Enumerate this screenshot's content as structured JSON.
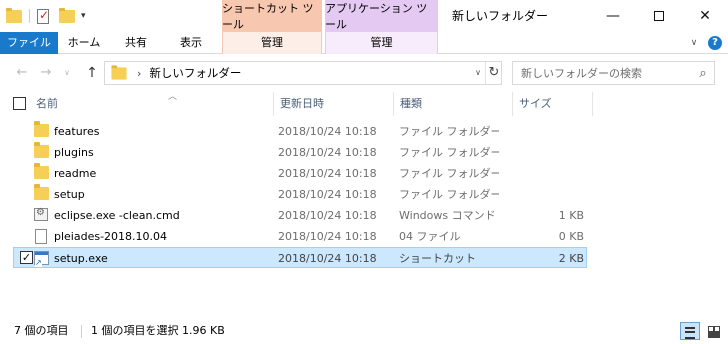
{
  "window": {
    "title": "新しいフォルダー",
    "context_tabs": {
      "shortcut_tools": "ショートカット ツール",
      "app_tools": "アプリケーション ツール"
    },
    "controls": {
      "minimize": "—",
      "close": "✕"
    }
  },
  "ribbon": {
    "tabs": {
      "file": "ファイル",
      "home": "ホーム",
      "share": "共有",
      "view": "表示",
      "manage1": "管理",
      "manage2": "管理"
    },
    "help": "?"
  },
  "address_bar": {
    "path": "新しいフォルダー",
    "search_placeholder": "新しいフォルダーの検索"
  },
  "columns": {
    "name": "名前",
    "date": "更新日時",
    "type": "種類",
    "size": "サイズ"
  },
  "files": [
    {
      "name": "features",
      "date": "2018/10/24 10:18",
      "type": "ファイル フォルダー",
      "size": "",
      "icon": "folder-icon",
      "selected": false
    },
    {
      "name": "plugins",
      "date": "2018/10/24 10:18",
      "type": "ファイル フォルダー",
      "size": "",
      "icon": "folder-icon",
      "selected": false
    },
    {
      "name": "readme",
      "date": "2018/10/24 10:18",
      "type": "ファイル フォルダー",
      "size": "",
      "icon": "folder-icon",
      "selected": false
    },
    {
      "name": "setup",
      "date": "2018/10/24 10:18",
      "type": "ファイル フォルダー",
      "size": "",
      "icon": "folder-icon",
      "selected": false
    },
    {
      "name": "eclipse.exe -clean.cmd",
      "date": "2018/10/24 10:18",
      "type": "Windows コマンド ...",
      "size": "1 KB",
      "icon": "cmd-file-icon",
      "selected": false
    },
    {
      "name": "pleiades-2018.10.04",
      "date": "2018/10/24 10:18",
      "type": "04 ファイル",
      "size": "0 KB",
      "icon": "file-icon",
      "selected": false
    },
    {
      "name": "setup.exe",
      "date": "2018/10/24 10:18",
      "type": "ショートカット",
      "size": "2 KB",
      "icon": "shortcut-exe-icon",
      "selected": true
    }
  ],
  "status": {
    "item_count": "7 個の項目",
    "selection": "1 個の項目を選択  1.96 KB"
  },
  "colors": {
    "accent": "#1979ca",
    "selection_bg": "#cce8ff",
    "selection_border": "#99d1ff",
    "shortcut_tools_tab": "#f7c7b0",
    "app_tools_tab": "#e4c9f3"
  }
}
